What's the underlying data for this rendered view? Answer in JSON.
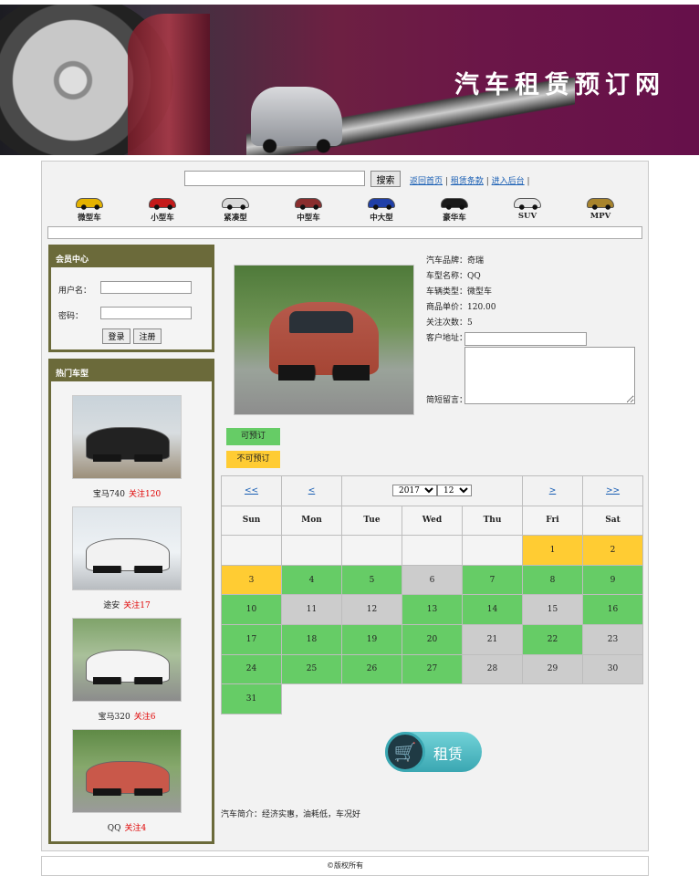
{
  "banner": {
    "title": "汽车租赁预订网"
  },
  "search": {
    "placeholder": "",
    "button": "搜索"
  },
  "toplinks": {
    "home": "返回首页",
    "terms": "租赁条款",
    "admin": "进入后台",
    "sep": "|"
  },
  "categories": [
    {
      "label": "微型车",
      "color": "#e5b300"
    },
    {
      "label": "小型车",
      "color": "#c41a1a"
    },
    {
      "label": "紧凑型",
      "color": "#d9d9d9"
    },
    {
      "label": "中型车",
      "color": "#8a2e2e"
    },
    {
      "label": "中大型",
      "color": "#1f3fa8"
    },
    {
      "label": "豪华车",
      "color": "#1a1a1a"
    },
    {
      "label": "SUV",
      "color": "#e6e6e6"
    },
    {
      "label": "MPV",
      "color": "#a8842c"
    }
  ],
  "member": {
    "title": "会员中心",
    "username_label": "用户名：",
    "password_label": "密码：",
    "login": "登录",
    "register": "注册"
  },
  "hot": {
    "title": "热门车型",
    "items": [
      {
        "name": "宝马740",
        "count": "关注120",
        "color": "#222222"
      },
      {
        "name": "途安",
        "count": "关注17",
        "color": "#f2f2f2"
      },
      {
        "name": "宝马320",
        "count": "关注6",
        "color": "#f4f4f4"
      },
      {
        "name": "QQ",
        "count": "关注4",
        "color": "#c9584a"
      }
    ]
  },
  "detail": {
    "brand": "汽车品牌：奇瑞",
    "model": "车型名称：QQ",
    "type": "车辆类型：微型车",
    "price": "商品单价：120.00",
    "follow": "关注次数：5",
    "address_label": "客户地址：",
    "message_label": "简短留言：",
    "intro": "汽车简介：经济实惠，油耗低，车况好"
  },
  "legend": {
    "available": "可预订",
    "unavailable": "不可预订"
  },
  "calendar": {
    "nav": {
      "prev_year": "<<",
      "prev_month": "<",
      "next_month": ">",
      "next_year": ">>"
    },
    "year": "2017",
    "month": "12",
    "weekdays": [
      "Sun",
      "Mon",
      "Tue",
      "Wed",
      "Thu",
      "Fri",
      "Sat"
    ],
    "weeks": [
      [
        null,
        null,
        null,
        null,
        null,
        {
          "d": "1",
          "s": "hl"
        },
        {
          "d": "2",
          "s": "hl"
        }
      ],
      [
        {
          "d": "3",
          "s": "hl"
        },
        {
          "d": "4",
          "s": "avail"
        },
        {
          "d": "5",
          "s": "avail"
        },
        {
          "d": "6",
          "s": "unav"
        },
        {
          "d": "7",
          "s": "avail"
        },
        {
          "d": "8",
          "s": "avail"
        },
        {
          "d": "9",
          "s": "avail"
        }
      ],
      [
        {
          "d": "10",
          "s": "avail"
        },
        {
          "d": "11",
          "s": "unav"
        },
        {
          "d": "12",
          "s": "unav"
        },
        {
          "d": "13",
          "s": "avail"
        },
        {
          "d": "14",
          "s": "avail"
        },
        {
          "d": "15",
          "s": "unav"
        },
        {
          "d": "16",
          "s": "avail"
        }
      ],
      [
        {
          "d": "17",
          "s": "avail"
        },
        {
          "d": "18",
          "s": "avail"
        },
        {
          "d": "19",
          "s": "avail"
        },
        {
          "d": "20",
          "s": "avail"
        },
        {
          "d": "21",
          "s": "unav"
        },
        {
          "d": "22",
          "s": "avail"
        },
        {
          "d": "23",
          "s": "unav"
        }
      ],
      [
        {
          "d": "24",
          "s": "avail"
        },
        {
          "d": "25",
          "s": "avail"
        },
        {
          "d": "26",
          "s": "avail"
        },
        {
          "d": "27",
          "s": "avail"
        },
        {
          "d": "28",
          "s": "unav"
        },
        {
          "d": "29",
          "s": "unav"
        },
        {
          "d": "30",
          "s": "unav"
        }
      ],
      [
        {
          "d": "31",
          "s": "avail"
        }
      ]
    ]
  },
  "rent": {
    "label": "租赁",
    "icon": "cart-icon"
  },
  "footer": {
    "text": "©版权所有"
  }
}
